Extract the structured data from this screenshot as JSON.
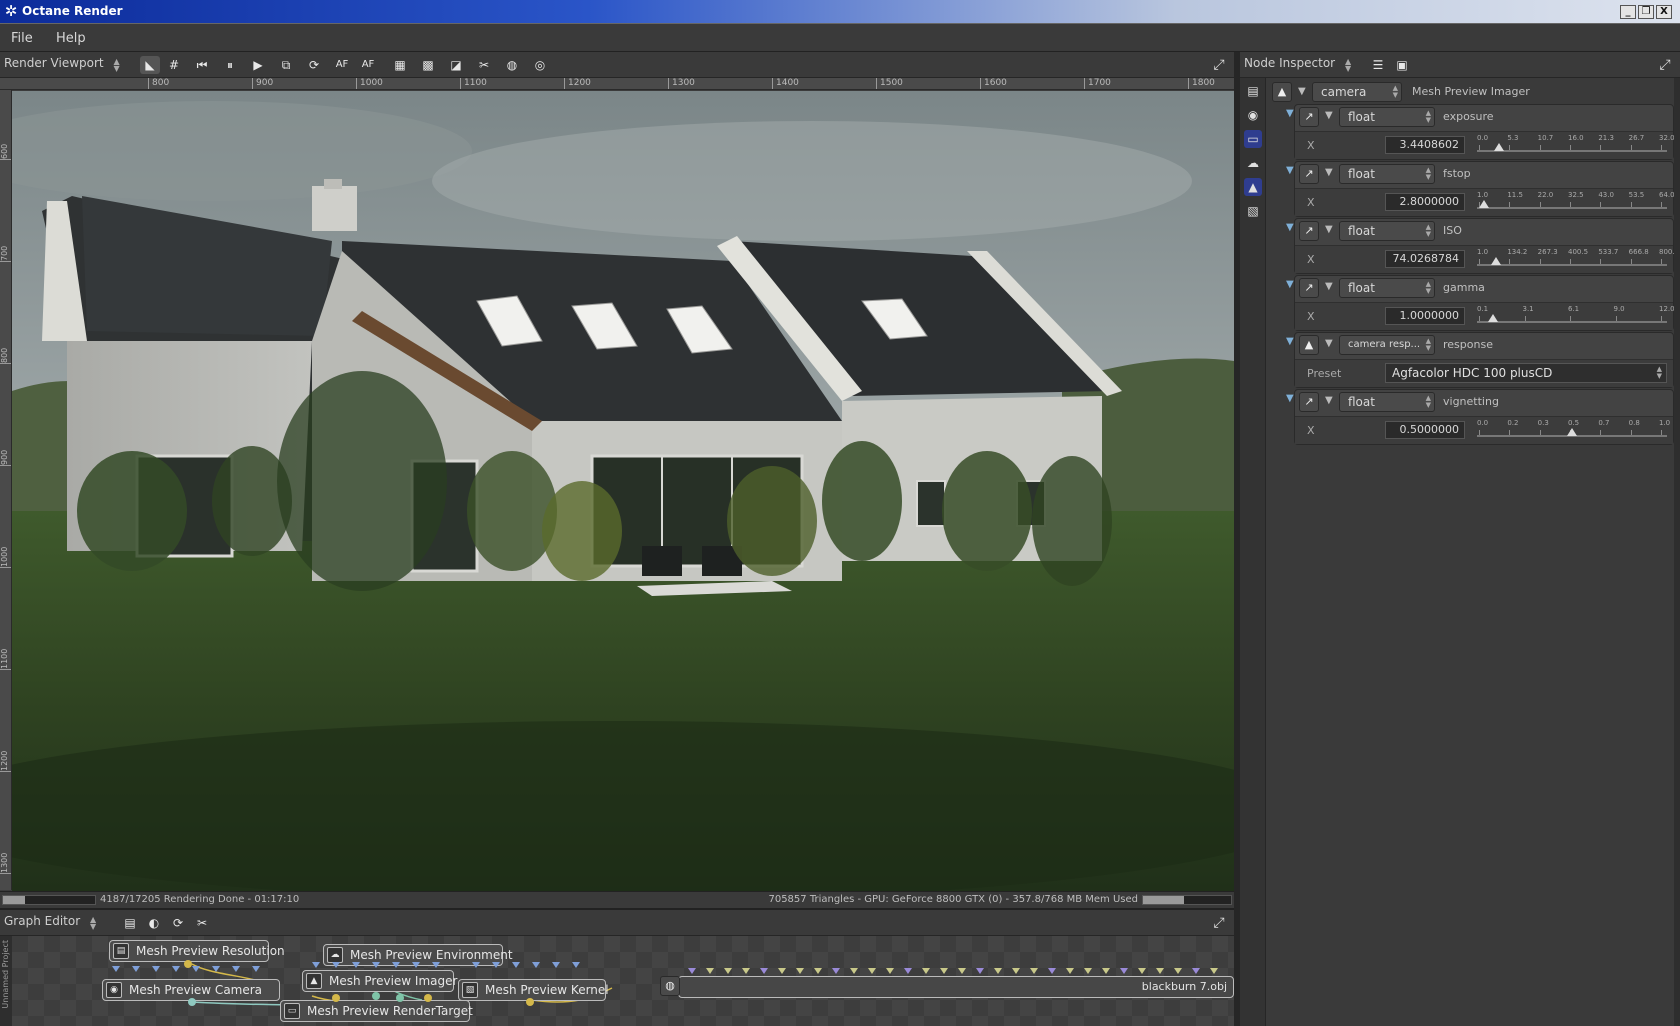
{
  "window": {
    "title": "Octane Render",
    "minimize": "_",
    "restore": "❐",
    "close": "X"
  },
  "menu": [
    "File",
    "Help"
  ],
  "viewport": {
    "panel_label": "Render Viewport",
    "ruler_x": [
      "800",
      "900",
      "1000",
      "1100",
      "1200",
      "1300",
      "1400",
      "1500",
      "1600",
      "1700",
      "1800"
    ],
    "ruler_y": [
      "600",
      "700",
      "800",
      "900",
      "1000",
      "1100",
      "1200",
      "1300"
    ],
    "toolbar": [
      {
        "name": "select-tool-icon",
        "glyph": "◣",
        "active": true
      },
      {
        "name": "grid-icon",
        "glyph": "#",
        "active": false
      },
      {
        "name": "restart-icon",
        "glyph": "⏮",
        "active": false
      },
      {
        "name": "pause-icon",
        "glyph": "⏸",
        "active": false
      },
      {
        "name": "play-icon",
        "glyph": "▶",
        "active": false
      },
      {
        "name": "region-icon",
        "glyph": "⧉",
        "active": false
      },
      {
        "name": "refresh-icon",
        "glyph": "⟳",
        "active": false
      },
      {
        "name": "autofocus-icon",
        "glyph": "AF",
        "active": false
      },
      {
        "name": "autofocus-pick-icon",
        "glyph": "AF",
        "active": false
      },
      {
        "name": "alpha-icon",
        "glyph": "▦",
        "active": false
      },
      {
        "name": "checker-icon",
        "glyph": "▩",
        "active": false
      },
      {
        "name": "half-icon",
        "glyph": "◪",
        "active": false
      },
      {
        "name": "material-pick-icon",
        "glyph": "✂",
        "active": false
      },
      {
        "name": "save-render-icon",
        "glyph": "◍",
        "active": false
      },
      {
        "name": "export-icon",
        "glyph": "◎",
        "active": false
      }
    ],
    "status_left": "4187/17205 Rendering Done - 01:17:10",
    "status_right": "705857 Triangles - GPU: GeForce 8800 GTX (0) - 357.8/768 MB Mem Used",
    "sample_progress": 0.243,
    "mem_progress": 0.466
  },
  "inspector": {
    "panel_label": "Node Inspector",
    "node_type": "camera",
    "node_name": "Mesh Preview Imager",
    "params": [
      {
        "type": "float",
        "name": "exposure",
        "axis": "X",
        "value": "3.4408602",
        "scale": [
          "0.0",
          "5.3",
          "10.7",
          "16.0",
          "21.3",
          "26.7",
          "32.0"
        ],
        "pos": 0.108
      },
      {
        "type": "float",
        "name": "fstop",
        "axis": "X",
        "value": "2.8000000",
        "scale": [
          "1.0",
          "11.5",
          "22.0",
          "32.5",
          "43.0",
          "53.5",
          "64.0"
        ],
        "pos": 0.029
      },
      {
        "type": "float",
        "name": "ISO",
        "axis": "X",
        "value": "74.0268784",
        "scale": [
          "1.0",
          "134.2",
          "267.3",
          "400.5",
          "533.7",
          "666.8",
          "800.0"
        ],
        "pos": 0.091
      },
      {
        "type": "float",
        "name": "gamma",
        "axis": "X",
        "value": "1.0000000",
        "scale": [
          "0.1",
          "3.1",
          "6.1",
          "9.0",
          "12.0"
        ],
        "pos": 0.075
      },
      {
        "type": "float",
        "name": "vignetting",
        "axis": "X",
        "value": "0.5000000",
        "scale": [
          "0.0",
          "0.2",
          "0.3",
          "0.5",
          "0.7",
          "0.8",
          "1.0"
        ],
        "pos": 0.5
      }
    ],
    "response": {
      "type": "camera resp...",
      "name": "response",
      "label": "Preset",
      "value": "Agfacolor HDC 100 plusCD"
    }
  },
  "graph": {
    "panel_label": "Graph Editor",
    "side_tab": "Unnamed Project",
    "nodes": [
      "Mesh Preview Resolution",
      "Mesh Preview Environment",
      "Mesh Preview Camera",
      "Mesh Preview Imager",
      "Mesh Preview Kernel",
      "Mesh Preview RenderTarget"
    ],
    "mesh_node": "blackburn 7.obj"
  }
}
